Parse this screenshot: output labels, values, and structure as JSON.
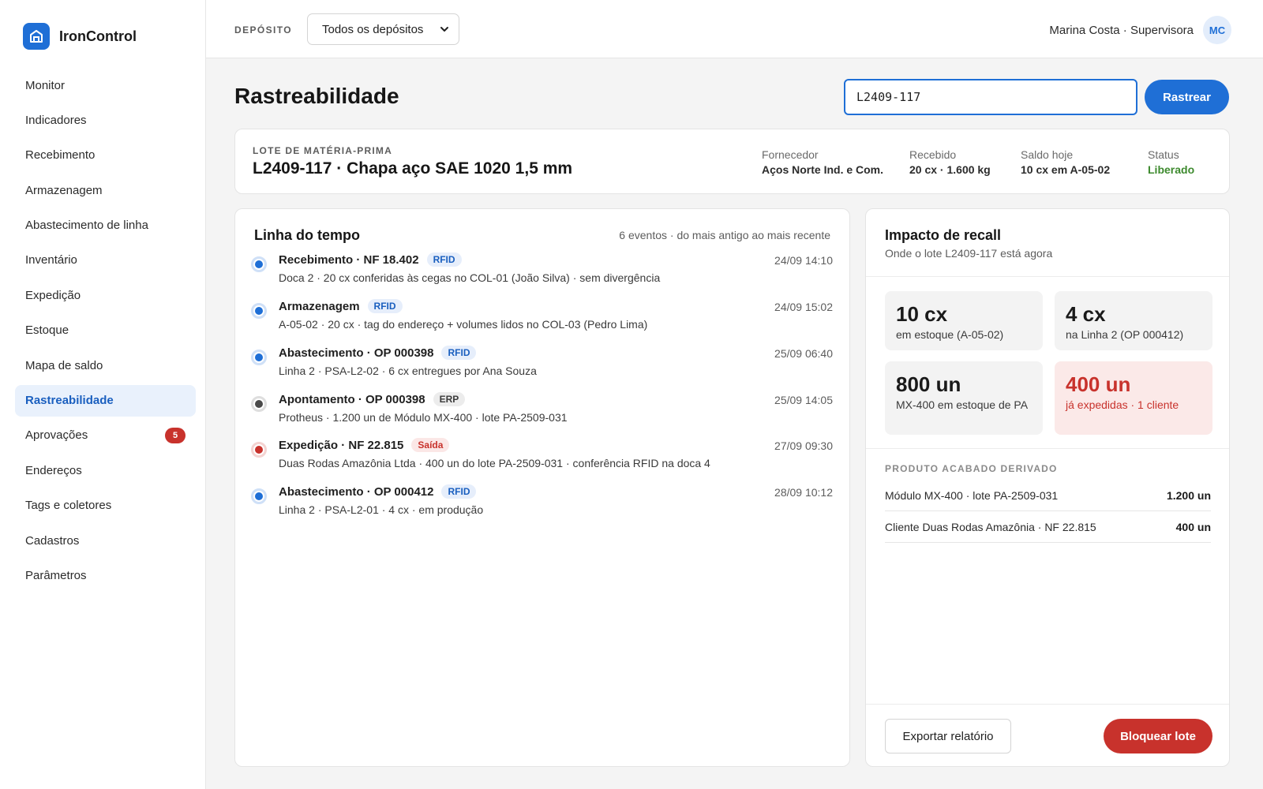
{
  "brand": {
    "name": "IronControl",
    "icon": "warehouse-icon"
  },
  "nav": [
    {
      "label": "Monitor",
      "active": false
    },
    {
      "label": "Indicadores",
      "active": false
    },
    {
      "label": "Recebimento",
      "active": false
    },
    {
      "label": "Armazenagem",
      "active": false
    },
    {
      "label": "Abastecimento de linha",
      "active": false
    },
    {
      "label": "Inventário",
      "active": false
    },
    {
      "label": "Expedição",
      "active": false
    },
    {
      "label": "Estoque",
      "active": false
    },
    {
      "label": "Mapa de saldo",
      "active": false
    },
    {
      "label": "Rastreabilidade",
      "active": true
    },
    {
      "label": "Aprovações",
      "active": false,
      "badge": "5"
    },
    {
      "label": "Endereços",
      "active": false
    },
    {
      "label": "Tags e coletores",
      "active": false
    },
    {
      "label": "Cadastros",
      "active": false
    },
    {
      "label": "Parâmetros",
      "active": false
    }
  ],
  "topbar": {
    "deposit_label": "DEPÓSITO",
    "deposit_value": "Todos os depósitos",
    "user_name": "Marina Costa · Supervisora",
    "user_initials": "MC"
  },
  "page": {
    "title": "Rastreabilidade",
    "search_value": "L2409-117",
    "track_label": "Rastrear"
  },
  "lot": {
    "label": "LOTE DE MATÉRIA-PRIMA",
    "title": "L2409-117 · Chapa aço SAE 1020 1,5 mm",
    "meta": [
      {
        "key": "Fornecedor",
        "value": "Aços Norte Ind. e Com."
      },
      {
        "key": "Recebido",
        "value": "20 cx · 1.600 kg"
      },
      {
        "key": "Saldo hoje",
        "value": "10 cx em A-05-02"
      },
      {
        "key": "Status",
        "value": "Liberado"
      }
    ]
  },
  "timeline": {
    "title": "Linha do tempo",
    "summary": "6 eventos · do mais antigo ao mais recente",
    "events": [
      {
        "title": "Recebimento · NF 18.402",
        "tag": "RFID",
        "time": "24/09 14:10",
        "desc": "Doca 2 · 20 cx conferidas às cegas no COL-01 (João Silva) · sem divergência"
      },
      {
        "title": "Armazenagem",
        "tag": "RFID",
        "time": "24/09 15:02",
        "desc": "A-05-02 · 20 cx · tag do endereço + volumes lidos no COL-03 (Pedro Lima)"
      },
      {
        "title": "Abastecimento · OP 000398",
        "tag": "RFID",
        "time": "25/09 06:40",
        "desc": "Linha 2 · PSA-L2-02 · 6 cx entregues por Ana Souza"
      },
      {
        "title": "Apontamento · OP 000398",
        "tag": "ERP",
        "time": "25/09 14:05",
        "desc": "Protheus · 1.200 un de Módulo MX-400 · lote PA-2509-031"
      },
      {
        "title": "Expedição · NF 22.815",
        "tag": "Saída",
        "time": "27/09 09:30",
        "desc": "Duas Rodas Amazônia Ltda · 400 un do lote PA-2509-031 · conferência RFID na doca 4"
      },
      {
        "title": "Abastecimento · OP 000412",
        "tag": "RFID",
        "time": "28/09 10:12",
        "desc": "Linha 2 · PSA-L2-01 · 4 cx · em produção"
      }
    ]
  },
  "recall": {
    "title": "Impacto de recall",
    "subtitle": "Onde o lote L2409-117 está agora",
    "stats": [
      {
        "num": "10 cx",
        "label": "em estoque (A-05-02)"
      },
      {
        "num": "4 cx",
        "label": "na Linha 2 (OP 000412)"
      },
      {
        "num": "800 un",
        "label": "MX-400 em estoque de PA"
      },
      {
        "num": "400 un",
        "label": "já expedidas · 1 cliente"
      }
    ],
    "derived_label": "PRODUTO ACABADO DERIVADO",
    "derived": [
      {
        "name": "Módulo MX-400 · lote PA-2509-031",
        "qty": "1.200 un"
      },
      {
        "name": "Cliente Duas Rodas Amazônia · NF 22.815",
        "qty": "400 un"
      }
    ],
    "export_label": "Exportar relatório",
    "block_label": "Bloquear lote"
  },
  "colors": {
    "accent": "#1f6fd6",
    "danger": "#c8322c",
    "success": "#3d8a2e"
  }
}
